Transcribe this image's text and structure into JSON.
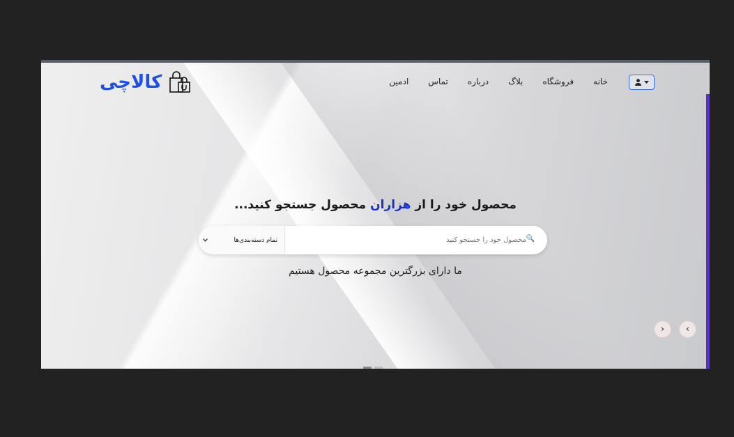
{
  "brand": {
    "name": "کالاچی",
    "icon": "shopping-bags-icon"
  },
  "nav": {
    "items": [
      {
        "label": "خانه"
      },
      {
        "label": "فروشگاه"
      },
      {
        "label": "بلاگ"
      },
      {
        "label": "درباره"
      },
      {
        "label": "تماس"
      },
      {
        "label": "ادمین"
      }
    ],
    "user_icon": "user-icon",
    "dropdown_icon": "caret-down-icon"
  },
  "hero": {
    "headline_part1": "محصول خود را از ",
    "headline_accent": "هزاران",
    "headline_part2": " محصول جستجو کنید...",
    "search_placeholder": "محصول خود را جستجو کنید",
    "search_icon": "search-icon",
    "category_select": "تمام دسته‌بندی‌ها",
    "subline": "ما دارای بزرگترین مجموعه محصول هستیم"
  },
  "colors": {
    "accent": "#1d4fe0",
    "scrollbar": "#5b2ed1",
    "page_bg": "#222222"
  }
}
